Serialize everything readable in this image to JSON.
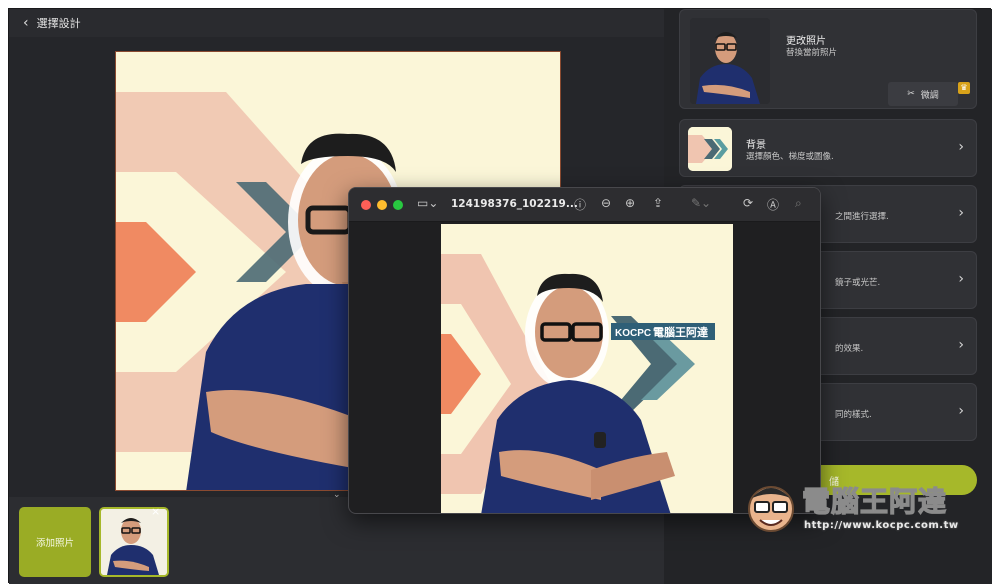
{
  "topbar": {
    "back_label": "選擇設計"
  },
  "bottom": {
    "add_photo_label": "添加照片",
    "close_symbol": "×"
  },
  "right_panel": {
    "change_photo": {
      "title": "更改照片",
      "desc": "替換當前照片",
      "adjust_label": "微調"
    },
    "background": {
      "title": "背景",
      "desc": "選擇顏色、梯度或圖像."
    },
    "cards": [
      {
        "desc": "之間進行選擇."
      },
      {
        "desc": "鏡子或光芒."
      },
      {
        "desc": "的效果."
      },
      {
        "desc": "同的樣式."
      }
    ],
    "save_partial_label": "儲"
  },
  "preview_window": {
    "filename": "124198376_102219...",
    "banner_prefix": "KOCPC",
    "banner_text": "電腦王阿達"
  },
  "watermark": {
    "text": "電腦王阿達",
    "url": "http://www.kocpc.com.tw"
  },
  "colors": {
    "accent": "#a6b82a",
    "panel": "#303135",
    "background": "#25262a",
    "canvas": "#fbf6d8",
    "shirt": "#1f2f6e",
    "peach": "#f0c5b0"
  }
}
